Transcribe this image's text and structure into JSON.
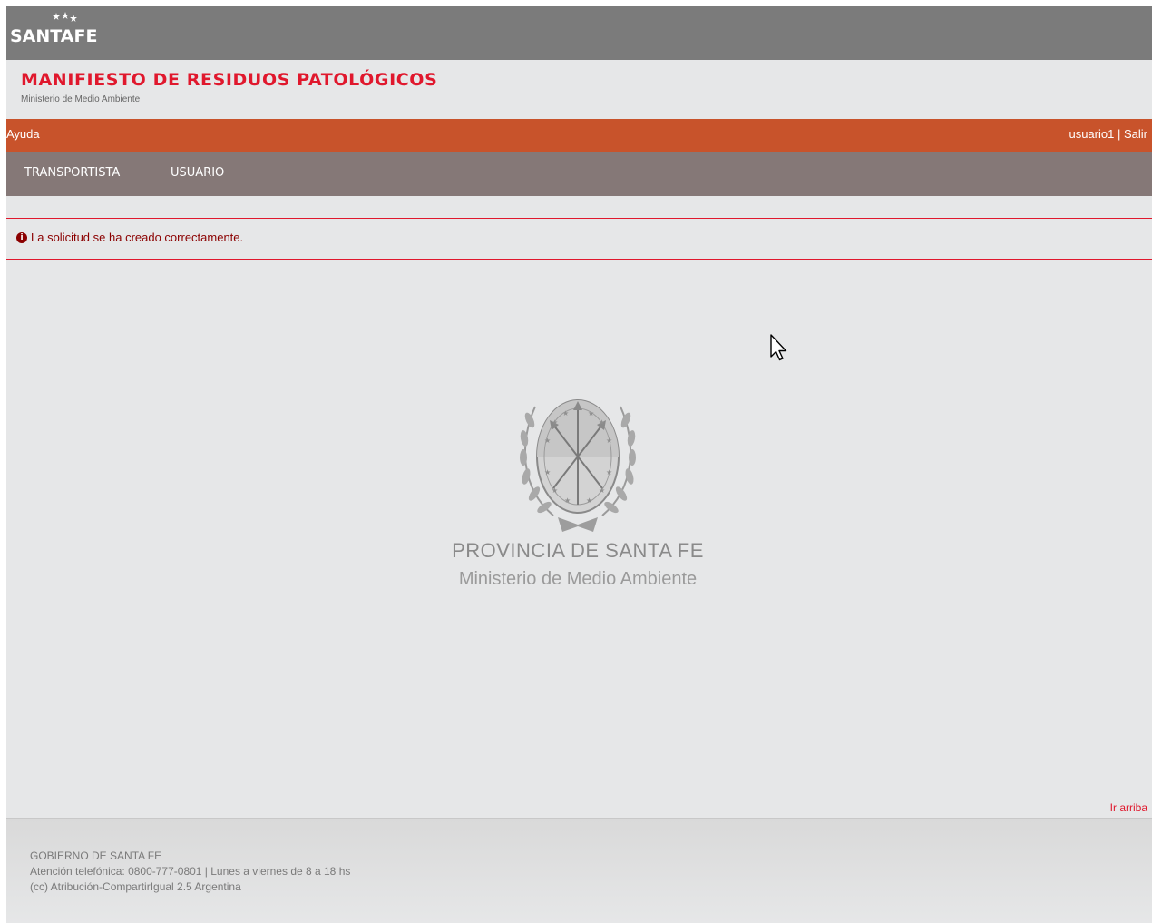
{
  "brand": {
    "logo_text_santa": "SANTA",
    "logo_text_fe": "FE"
  },
  "header": {
    "title": "MANIFIESTO DE RESIDUOS PATOLÓGICOS",
    "subtitle": "Ministerio de Medio Ambiente"
  },
  "topbar": {
    "help_label": "Ayuda",
    "username": "usuario1",
    "separator": "|",
    "logout_label": "Salir"
  },
  "nav": {
    "items": [
      {
        "label": "TRANSPORTISTA"
      },
      {
        "label": "USUARIO"
      }
    ]
  },
  "alert": {
    "icon": "info-icon",
    "message": "La solicitud se ha creado correctamente."
  },
  "main": {
    "province_title": "PROVINCIA DE SANTA FE",
    "province_subtitle": "Ministerio de Medio Ambiente"
  },
  "footer": {
    "back_to_top": "Ir arriba",
    "lines": [
      "GOBIERNO DE SANTA FE",
      "Atención telefónica: 0800-777-0801 | Lunes a viernes de 8 a 18 hs",
      "(cc) Atribución-CompartirIgual 2.5 Argentina"
    ]
  },
  "colors": {
    "accent_red": "#e0182d",
    "orange_bar": "#c8532b",
    "nav_bar": "#857877",
    "top_bar": "#7b7b7b",
    "page_bg": "#e6e7e8"
  }
}
